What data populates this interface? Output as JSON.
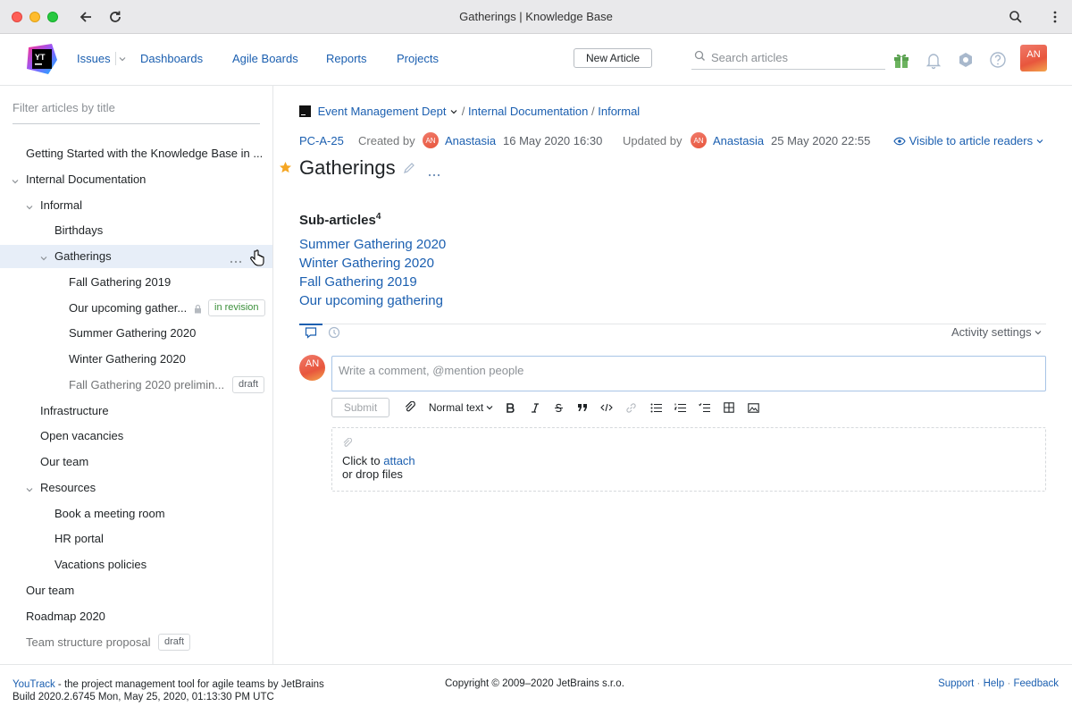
{
  "window": {
    "title": "Gatherings | Knowledge Base"
  },
  "header": {
    "logo_text": "YT",
    "nav": [
      "Issues",
      "Dashboards",
      "Agile Boards",
      "Reports",
      "Projects"
    ],
    "new_article": "New Article",
    "search_placeholder": "Search articles",
    "avatar": "AN"
  },
  "sidebar": {
    "filter_placeholder": "Filter articles by title",
    "items": [
      {
        "label": "Getting Started with the Knowledge Base in ..."
      },
      {
        "label": "Internal Documentation"
      },
      {
        "label": "Informal"
      },
      {
        "label": "Birthdays"
      },
      {
        "label": "Gatherings"
      },
      {
        "label": "Fall Gathering 2019"
      },
      {
        "label": "Our upcoming gather...",
        "tag": "in revision"
      },
      {
        "label": "Summer Gathering 2020"
      },
      {
        "label": "Winter Gathering 2020"
      },
      {
        "label": "Fall Gathering 2020 prelimin...",
        "tag": "draft"
      },
      {
        "label": "Infrastructure"
      },
      {
        "label": "Open vacancies"
      },
      {
        "label": "Our team"
      },
      {
        "label": "Resources"
      },
      {
        "label": "Book a meeting room"
      },
      {
        "label": "HR portal"
      },
      {
        "label": "Vacations policies"
      },
      {
        "label": "Our team"
      },
      {
        "label": "Roadmap 2020"
      },
      {
        "label": "Team structure proposal",
        "tag": "draft"
      }
    ]
  },
  "article": {
    "breadcrumb": {
      "project": "Event Management Dept",
      "sep": "/",
      "parent": "Internal Documentation",
      "current": "Informal"
    },
    "id": "PC-A-25",
    "created_label": "Created by",
    "author": "Anastasia",
    "created_date": "16 May 2020 16:30",
    "updated_label": "Updated by",
    "updater": "Anastasia",
    "updated_date": "25 May 2020 22:55",
    "visibility": "Visible to article readers",
    "title": "Gatherings",
    "subarticles_label": "Sub-articles",
    "subarticles_count": "4",
    "subarticles": [
      "Summer Gathering 2020",
      "Winter Gathering 2020",
      "Fall Gathering 2019",
      "Our upcoming gathering"
    ]
  },
  "activity": {
    "settings_label": "Activity settings",
    "comment_placeholder": "Write a comment, @mention people",
    "submit": "Submit",
    "text_style": "Normal text",
    "attach_prefix": "Click to",
    "attach_link": "attach",
    "attach_suffix": "or drop files",
    "avatar": "AN"
  },
  "footer": {
    "brand": "YouTrack",
    "tagline": " - the project management tool for agile teams by JetBrains",
    "build": "Build 2020.2.6745 Mon, May 25, 2020, 01:13:30 PM UTC",
    "copyright": "Copyright © 2009–2020 JetBrains s.r.o.",
    "links": [
      "Support",
      "Help",
      "Feedback"
    ],
    "link_sep": " · "
  },
  "colors": {
    "accent": "#1b5fb0",
    "star": "#f5a623",
    "selected_bg": "#e7eef8"
  }
}
